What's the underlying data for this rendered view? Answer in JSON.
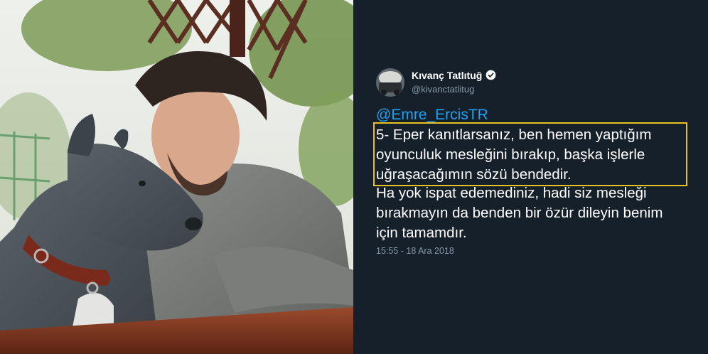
{
  "tweet": {
    "author_name": "Kıvanç Tatlıtuğ",
    "author_handle": "@kivanctatlitug",
    "mention": "@Emre_ErcisTR",
    "highlighted_lines": [
      "5- Eper kanıtlarsanız, ben hemen yaptığım",
      "oyunculuk mesleğini bırakıp, başka işlerle",
      "uğraşacağımın sözü bendedir."
    ],
    "body_lines": [
      "Ha yok ispat edemediniz, hadi siz mesleği",
      "bırakmayın da benden bir özür dileyin benim",
      "için tamamdır."
    ],
    "timestamp": "15:55 - 18 Ara 2018"
  },
  "colors": {
    "card_background": "#15202b",
    "link": "#1da1f2",
    "highlight_border": "#e9c021",
    "muted_text": "#8899a6",
    "verified_badge": "#ffffff"
  },
  "icons": {
    "verified": "verified-badge-icon"
  }
}
